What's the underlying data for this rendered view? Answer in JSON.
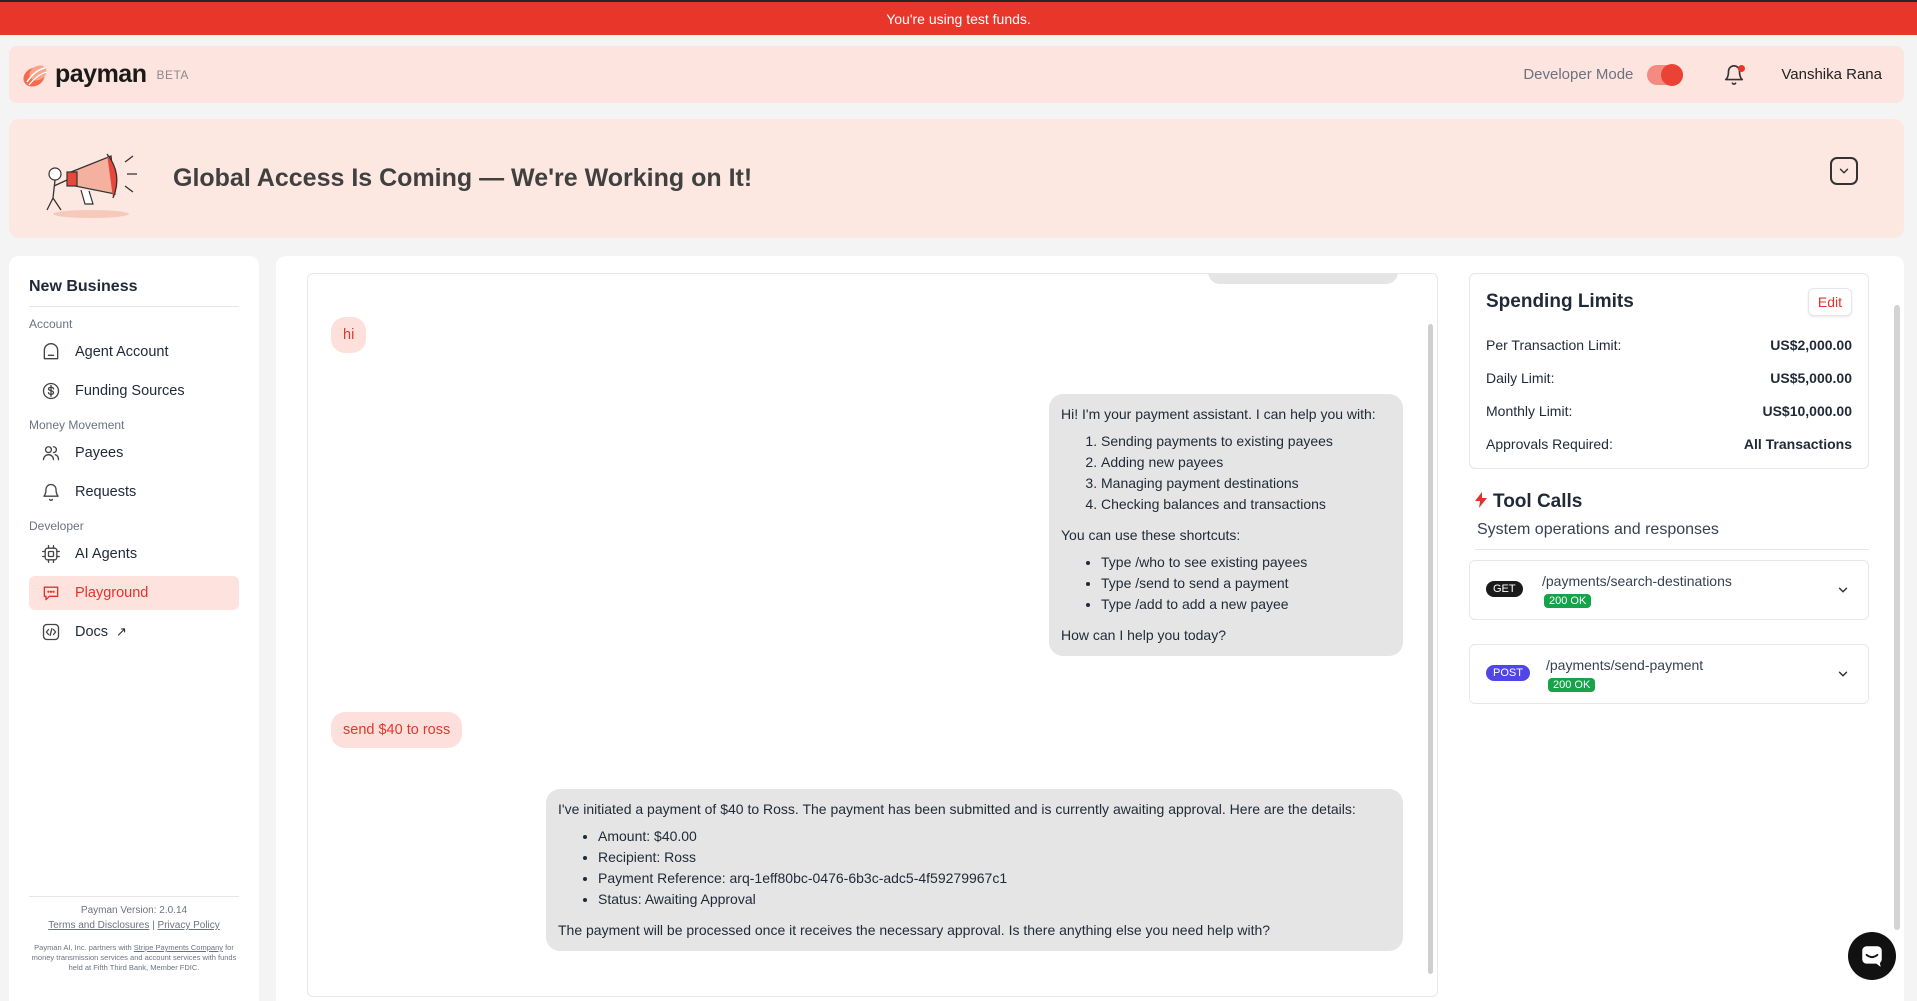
{
  "banner": {
    "text": "You're using test funds."
  },
  "topbar": {
    "brand": "payman",
    "beta": "BETA",
    "developer_mode_label": "Developer Mode",
    "developer_mode_on": true,
    "user_name": "Vanshika Rana"
  },
  "promo": {
    "title": "Global Access Is Coming — We're Working on It!"
  },
  "sidebar": {
    "business_name": "New Business",
    "sections": {
      "account": "Account",
      "money_movement": "Money Movement",
      "developer": "Developer"
    },
    "items": {
      "agent_account": "Agent Account",
      "funding_sources": "Funding Sources",
      "payees": "Payees",
      "requests": "Requests",
      "ai_agents": "AI Agents",
      "playground": "Playground",
      "docs": "Docs"
    },
    "footer": {
      "version": "Payman Version: 2.0.14",
      "terms": "Terms and Disclosures",
      "privacy": "Privacy Policy",
      "disclaimer_pre": "Payman AI, Inc. partners with ",
      "disclaimer_link": "Stripe Payments Company",
      "disclaimer_post": " for money transmission services and account services with funds held at Fifth Third Bank, Member FDIC."
    }
  },
  "chat": {
    "msg1": "hi",
    "msg2": {
      "intro": "Hi! I'm your payment assistant. I can help you with:",
      "items": [
        "Sending payments to existing payees",
        "Adding new payees",
        "Managing payment destinations",
        "Checking balances and transactions"
      ],
      "shortcuts_intro": "You can use these shortcuts:",
      "shortcuts": [
        "Type /who to see existing payees",
        "Type /send to send a payment",
        "Type /add to add a new payee"
      ],
      "closing": "How can I help you today?"
    },
    "msg3": "send $40 to ross",
    "msg4": {
      "intro": "I've initiated a payment of $40 to Ross. The payment has been submitted and is currently awaiting approval. Here are the details:",
      "items": [
        "Amount: $40.00",
        "Recipient: Ross",
        "Payment Reference: arq-1eff80bc-0476-6b3c-adc5-4f59279967c1",
        "Status: Awaiting Approval"
      ],
      "closing": "The payment will be processed once it receives the necessary approval. Is there anything else you need help with?"
    }
  },
  "limits": {
    "title": "Spending Limits",
    "edit_label": "Edit",
    "rows": [
      {
        "label": "Per Transaction Limit:",
        "value": "US$2,000.00"
      },
      {
        "label": "Daily Limit:",
        "value": "US$5,000.00"
      },
      {
        "label": "Monthly Limit:",
        "value": "US$10,000.00"
      },
      {
        "label": "Approvals Required:",
        "value": "All Transactions"
      }
    ]
  },
  "tools": {
    "title": "Tool Calls",
    "subtitle": "System operations and responses",
    "calls": [
      {
        "method": "GET",
        "path": "/payments/search-destinations",
        "status": "200 OK"
      },
      {
        "method": "POST",
        "path": "/payments/send-payment",
        "status": "200 OK"
      }
    ]
  },
  "colors": {
    "accent": "#e8372a",
    "banner": "#e8372a",
    "success": "#16a34a",
    "post": "#4f46e5"
  }
}
